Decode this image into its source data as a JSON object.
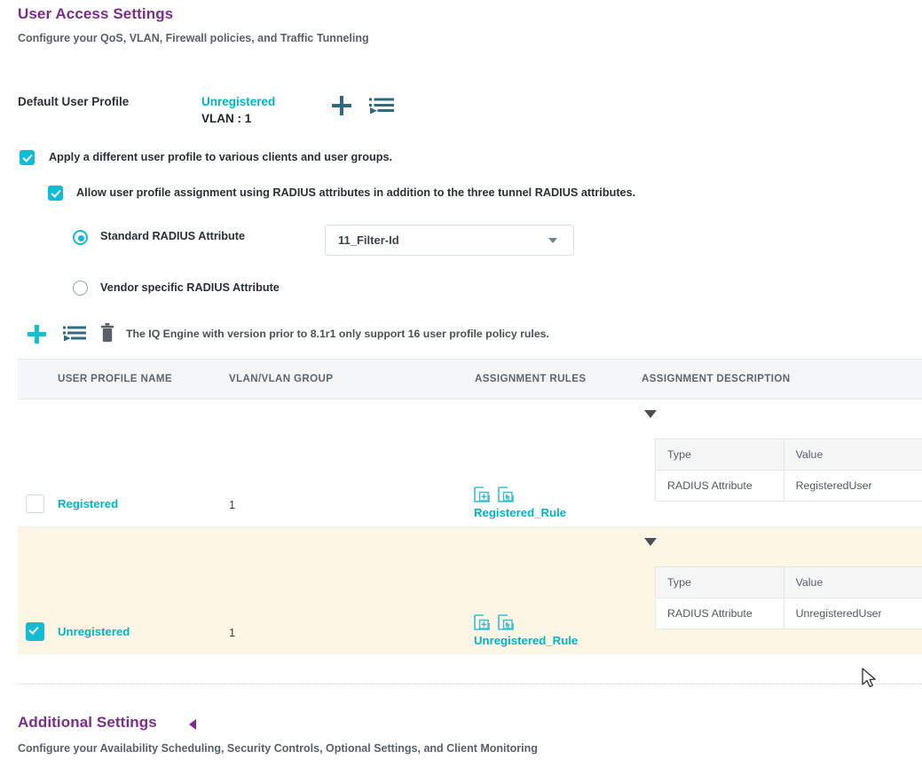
{
  "section": {
    "title": "User Access Settings",
    "subtitle": "Configure your QoS, VLAN, Firewall policies, and Traffic Tunneling"
  },
  "default_profile": {
    "label": "Default User Profile",
    "value": "Unregistered",
    "vlan": "VLAN : 1",
    "add_icon": "plus-icon",
    "list_icon": "assign-list-icon"
  },
  "options": {
    "apply_different_profile": {
      "label": "Apply a different user profile to various clients and user groups.",
      "checked": true
    },
    "allow_radius_assignment": {
      "label": "Allow user profile assignment using RADIUS attributes in addition to the three tunnel RADIUS attributes.",
      "checked": true
    },
    "radio_group": [
      {
        "label": "Standard RADIUS Attribute",
        "selected": true
      },
      {
        "label": "Vendor specific RADIUS Attribute",
        "selected": false
      }
    ],
    "attribute_select": {
      "value": "11_Filter-Id",
      "caret": "chevron-down-icon"
    }
  },
  "toolbar": {
    "add_icon": "plus-icon",
    "assign_icon": "assign-list-icon",
    "delete_icon": "trash-icon",
    "note": "The IQ Engine with version prior to 8.1r1 only support 16 user profile policy rules."
  },
  "table": {
    "columns": [
      "USER PROFILE NAME",
      "VLAN/VLAN GROUP",
      "ASSIGNMENT RULES",
      "ASSIGNMENT DESCRIPTION"
    ],
    "rows": [
      {
        "selected": false,
        "name": "Registered",
        "vlan": "1",
        "rule_name": "Registered_Rule",
        "rule_add_icon": "add-rule-icon",
        "rule_pick_icon": "select-rule-icon",
        "expand_icon": "caret-down-icon",
        "description": {
          "headers": [
            "Type",
            "Value"
          ],
          "rows": [
            [
              "RADIUS Attribute",
              "RegisteredUser"
            ]
          ]
        }
      },
      {
        "selected": true,
        "name": "Unregistered",
        "vlan": "1",
        "rule_name": "Unregistered_Rule",
        "rule_add_icon": "add-rule-icon",
        "rule_pick_icon": "select-rule-icon",
        "expand_icon": "caret-down-icon",
        "description": {
          "headers": [
            "Type",
            "Value"
          ],
          "rows": [
            [
              "RADIUS Attribute",
              "UnregisteredUser"
            ]
          ]
        }
      }
    ]
  },
  "additional": {
    "title": "Additional Settings",
    "collapse_icon": "caret-left-icon",
    "subtitle": "Configure your Availability Scheduling, Security Controls, Optional Settings, and Client Monitoring"
  },
  "colors": {
    "heading": "#7b2d8e",
    "accent": "#00b4c8",
    "checkbox": "#12bcd4",
    "row_highlight": "#fdf6e4"
  }
}
